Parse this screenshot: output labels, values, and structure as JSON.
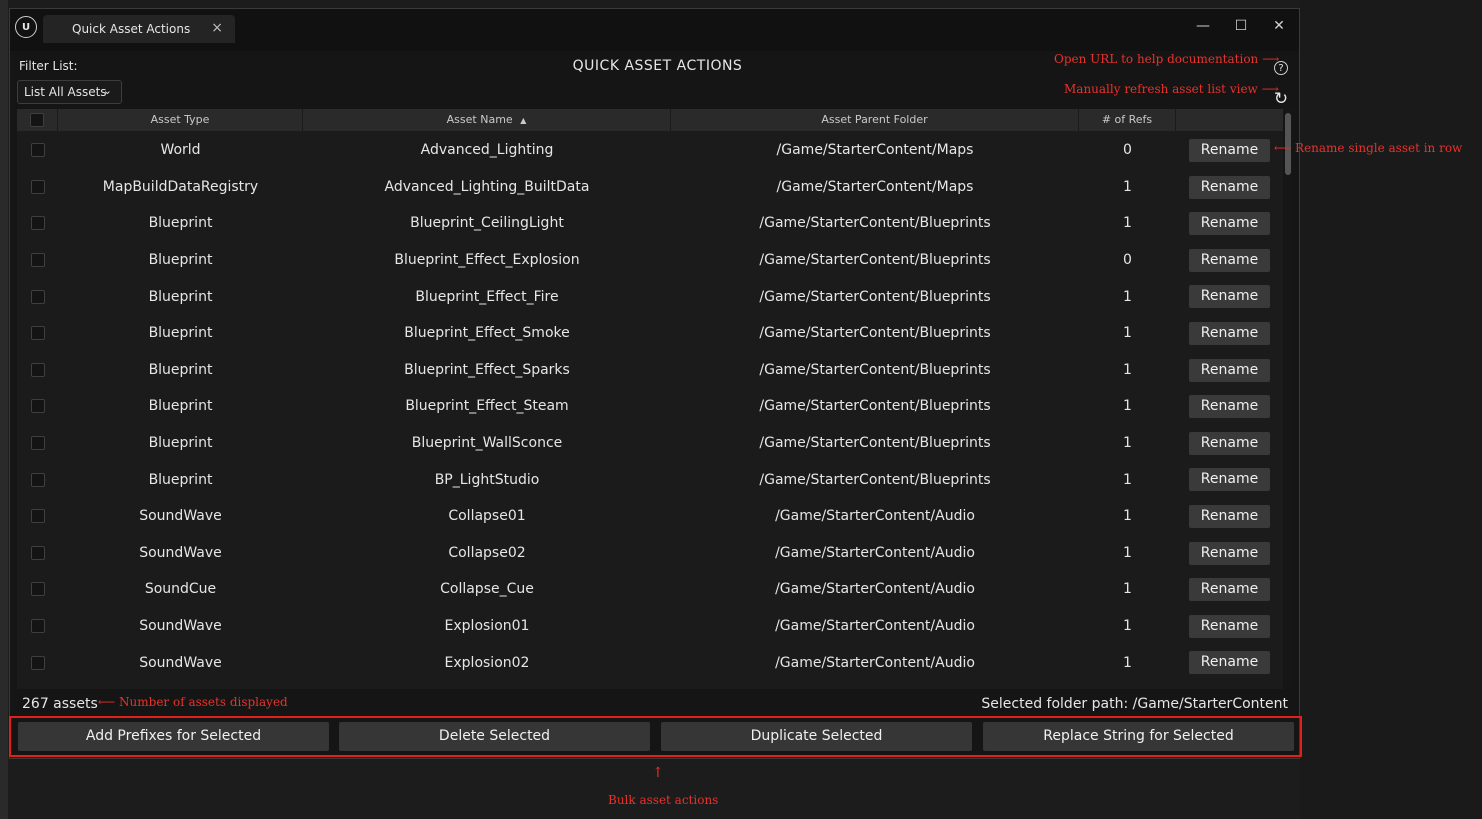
{
  "window": {
    "tab_title": "Quick Asset Actions",
    "tab_close_glyph": "×",
    "minimize_glyph": "—",
    "maximize_glyph": "☐",
    "close_glyph": "✕"
  },
  "header": {
    "filter_label": "Filter List:",
    "filter_value": "List All Assets",
    "title": "QUICK ASSET ACTIONS"
  },
  "table": {
    "columns": [
      "Asset Type",
      "Asset Name",
      "Asset Parent Folder",
      "# of Refs"
    ],
    "sort_indicator": "▲",
    "rename_label": "Rename",
    "rows": [
      {
        "type": "World",
        "name": "Advanced_Lighting",
        "folder": "/Game/StarterContent/Maps",
        "refs": "0"
      },
      {
        "type": "MapBuildDataRegistry",
        "name": "Advanced_Lighting_BuiltData",
        "folder": "/Game/StarterContent/Maps",
        "refs": "1"
      },
      {
        "type": "Blueprint",
        "name": "Blueprint_CeilingLight",
        "folder": "/Game/StarterContent/Blueprints",
        "refs": "1"
      },
      {
        "type": "Blueprint",
        "name": "Blueprint_Effect_Explosion",
        "folder": "/Game/StarterContent/Blueprints",
        "refs": "0"
      },
      {
        "type": "Blueprint",
        "name": "Blueprint_Effect_Fire",
        "folder": "/Game/StarterContent/Blueprints",
        "refs": "1"
      },
      {
        "type": "Blueprint",
        "name": "Blueprint_Effect_Smoke",
        "folder": "/Game/StarterContent/Blueprints",
        "refs": "1"
      },
      {
        "type": "Blueprint",
        "name": "Blueprint_Effect_Sparks",
        "folder": "/Game/StarterContent/Blueprints",
        "refs": "1"
      },
      {
        "type": "Blueprint",
        "name": "Blueprint_Effect_Steam",
        "folder": "/Game/StarterContent/Blueprints",
        "refs": "1"
      },
      {
        "type": "Blueprint",
        "name": "Blueprint_WallSconce",
        "folder": "/Game/StarterContent/Blueprints",
        "refs": "1"
      },
      {
        "type": "Blueprint",
        "name": "BP_LightStudio",
        "folder": "/Game/StarterContent/Blueprints",
        "refs": "1"
      },
      {
        "type": "SoundWave",
        "name": "Collapse01",
        "folder": "/Game/StarterContent/Audio",
        "refs": "1"
      },
      {
        "type": "SoundWave",
        "name": "Collapse02",
        "folder": "/Game/StarterContent/Audio",
        "refs": "1"
      },
      {
        "type": "SoundCue",
        "name": "Collapse_Cue",
        "folder": "/Game/StarterContent/Audio",
        "refs": "1"
      },
      {
        "type": "SoundWave",
        "name": "Explosion01",
        "folder": "/Game/StarterContent/Audio",
        "refs": "1"
      },
      {
        "type": "SoundWave",
        "name": "Explosion02",
        "folder": "/Game/StarterContent/Audio",
        "refs": "1"
      }
    ]
  },
  "footer": {
    "asset_count": "267 assets",
    "folder_path": "Selected folder path: /Game/StarterContent"
  },
  "bulk_actions": [
    "Add Prefixes for Selected",
    "Delete Selected",
    "Duplicate Selected",
    "Replace String for Selected"
  ],
  "annotations": {
    "help": "Open URL to help documentation",
    "refresh": "Manually refresh asset list view",
    "rename": "Rename single asset in row",
    "count": "Number of assets displayed",
    "bulk": "Bulk asset actions",
    "color": "#e8322c"
  }
}
